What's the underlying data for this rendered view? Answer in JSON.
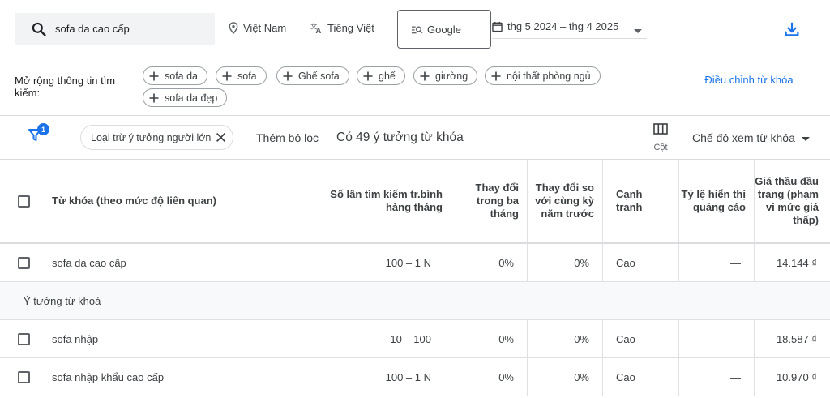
{
  "search": {
    "query": "sofa da cao cấp"
  },
  "location": {
    "label": "Việt Nam"
  },
  "language": {
    "label": "Tiếng Việt"
  },
  "network": {
    "label": "Google"
  },
  "date_range": {
    "label": "thg 5 2024 – thg 4 2025"
  },
  "refine": {
    "label": "Mở rộng thông tin tìm kiếm:",
    "chips": [
      "sofa da",
      "sofa",
      "Ghế sofa",
      "ghế",
      "giường",
      "nội thất phòng ngủ",
      "sofa da đẹp"
    ],
    "adjust_link": "Điều chỉnh từ khóa"
  },
  "filters": {
    "badge_count": "1",
    "active_filter": "Loại trừ ý tưởng người lớn",
    "add_filter": "Thêm bộ lọc",
    "idea_count": "Có 49 ý tưởng từ khóa",
    "columns_label": "Cột",
    "view_mode": "Chế độ xem từ khóa"
  },
  "table": {
    "headers": {
      "keyword": "Từ khóa (theo mức độ liên quan)",
      "avg_searches": "Số lần tìm kiếm tr.bình hàng tháng",
      "three_month": "Thay đổi trong ba tháng",
      "yoy": "Thay đổi so với cùng kỳ năm trước",
      "competition": "Cạnh tranh",
      "impression_share": "Tỷ lệ hiển thị quảng cáo",
      "top_bid_low": "Giá thầu đầu trang (phạm vi mức giá thấp)"
    },
    "provided_row": {
      "keyword": "sofa da cao cấp",
      "avg_searches": "100 – 1 N",
      "three_month": "0%",
      "yoy": "0%",
      "competition": "Cao",
      "impression_share": "—",
      "top_bid_low": "14.144 ₫"
    },
    "section_label": "Ý tưởng từ khoá",
    "rows": [
      {
        "keyword": "sofa nhập",
        "avg_searches": "10 – 100",
        "three_month": "0%",
        "yoy": "0%",
        "competition": "Cao",
        "impression_share": "—",
        "top_bid_low": "18.587 ₫"
      },
      {
        "keyword": "sofa nhập khẩu cao cấp",
        "avg_searches": "100 – 1 N",
        "three_month": "0%",
        "yoy": "0%",
        "competition": "Cao",
        "impression_share": "—",
        "top_bid_low": "10.970 ₫"
      }
    ]
  },
  "colors": {
    "accent": "#1a73e8",
    "border": "#dadce0",
    "text": "#3c4043"
  }
}
